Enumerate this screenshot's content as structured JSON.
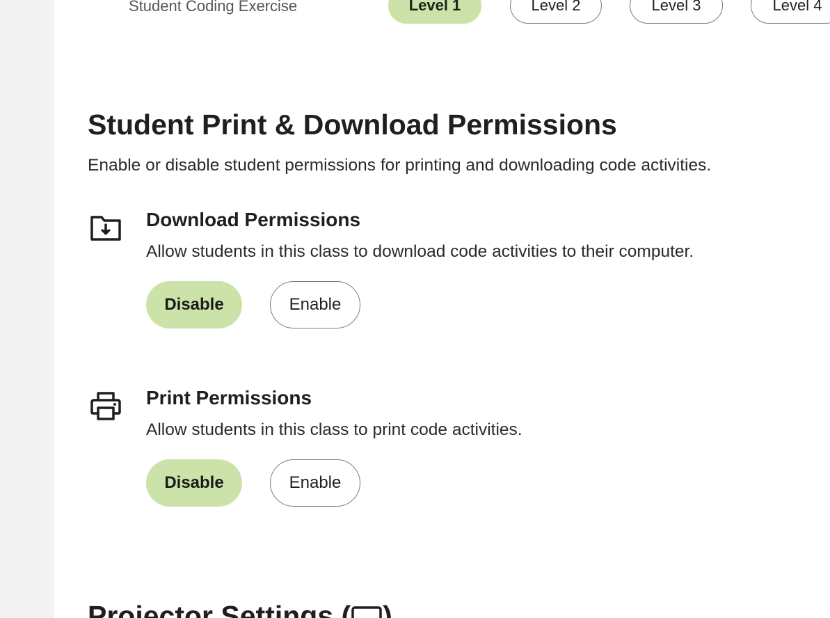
{
  "top_row": {
    "exercise_label": "Student Coding Exercise",
    "levels": [
      "Level 1",
      "Level 2",
      "Level 3",
      "Level 4"
    ],
    "active_level": "Level 1"
  },
  "section": {
    "title": "Student Print & Download Permissions",
    "description": "Enable or disable student permissions for printing and downloading code activities."
  },
  "permissions": [
    {
      "icon": "folder-download-icon",
      "title": "Download Permissions",
      "description": "Allow students in this class to download code activities to their computer.",
      "disable_label": "Disable",
      "enable_label": "Enable",
      "selected": "Disable"
    },
    {
      "icon": "printer-icon",
      "title": "Print Permissions",
      "description": "Allow students in this class to print code activities.",
      "disable_label": "Disable",
      "enable_label": "Enable",
      "selected": "Disable"
    }
  ],
  "next_section": {
    "title": "Projector Settings (",
    "title_suffix": ")",
    "icon": "projector-icon"
  },
  "colors": {
    "accent": "#cbe3a8",
    "rail": "#f3f3f3",
    "border": "#7a7a7a",
    "text": "#1f1f1f"
  }
}
